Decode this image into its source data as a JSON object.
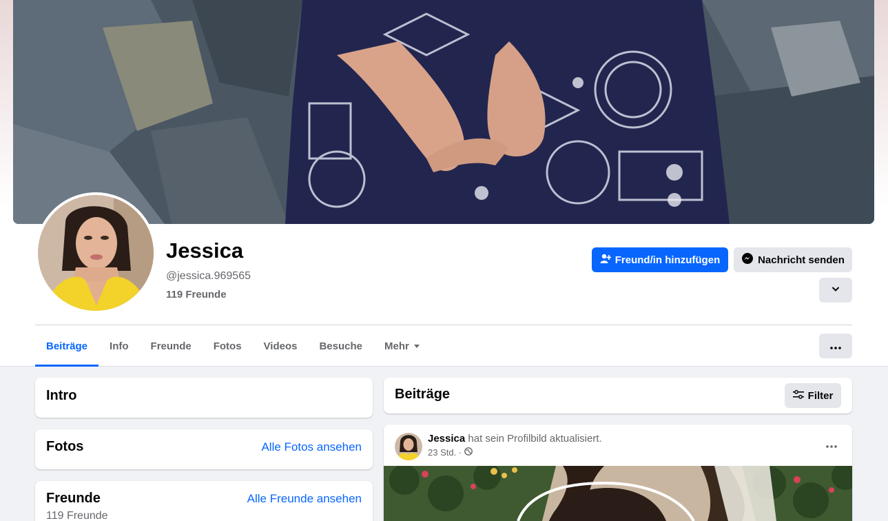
{
  "profile": {
    "name": "Jessica",
    "handle": "@jessica.969565",
    "friends_count": "119 Freunde"
  },
  "actions": {
    "add_friend": "Freund/in hinzufügen",
    "message": "Nachricht senden"
  },
  "tabs": [
    {
      "label": "Beiträge",
      "active": true
    },
    {
      "label": "Info"
    },
    {
      "label": "Freunde"
    },
    {
      "label": "Fotos"
    },
    {
      "label": "Videos"
    },
    {
      "label": "Besuche"
    },
    {
      "label": "Mehr"
    }
  ],
  "left": {
    "intro_title": "Intro",
    "photos_title": "Fotos",
    "photos_link": "Alle Fotos ansehen",
    "friends_title": "Freunde",
    "friends_link": "Alle Freunde ansehen",
    "friends_count": "119 Freunde"
  },
  "posts": {
    "title": "Beiträge",
    "filter": "Filter",
    "post": {
      "author": "Jessica",
      "text": "hat sein Profilbild aktualisiert.",
      "time": "23 Std. ·"
    }
  },
  "colors": {
    "accent": "#0866ff",
    "secondary_button": "#e4e6eb",
    "background": "#f0f2f5"
  },
  "icons": [
    "person-add-icon",
    "messenger-icon",
    "chevron-down-icon",
    "more-dots-icon",
    "caret-down-icon",
    "filter-sliders-icon",
    "globe-icon"
  ]
}
